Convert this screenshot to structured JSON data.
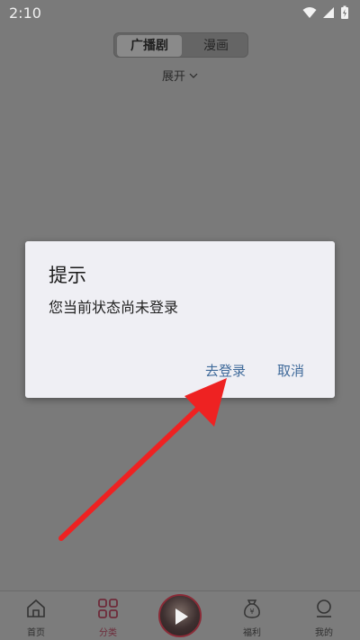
{
  "status_bar": {
    "time": "2:10"
  },
  "header": {
    "segments": [
      {
        "label": "广播剧",
        "active": true
      },
      {
        "label": "漫画",
        "active": false
      }
    ],
    "expand_label": "展开"
  },
  "dialog": {
    "title": "提示",
    "message": "您当前状态尚未登录",
    "login_label": "去登录",
    "cancel_label": "取消"
  },
  "tabbar": {
    "items": [
      {
        "label": "首页",
        "icon": "home-icon"
      },
      {
        "label": "分类",
        "icon": "category-icon",
        "active": true
      },
      {
        "label": "福利",
        "icon": "welfare-bag-icon"
      },
      {
        "label": "我的",
        "icon": "profile-icon"
      }
    ],
    "center_icon": "play-icon"
  },
  "colors": {
    "accent_link": "#3f6a9a",
    "active_tab": "#6e2b3a",
    "annotation_arrow": "#ee2222"
  }
}
